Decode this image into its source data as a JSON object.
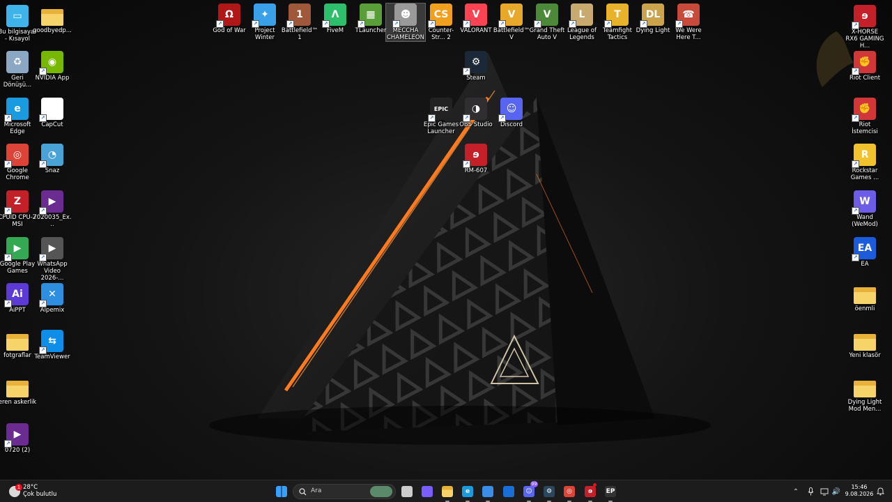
{
  "desktop": {
    "left_icons": [
      {
        "label": "Bu bilgisayar - Kısayol",
        "icon": "computer-icon",
        "color": "#3fb4ea"
      },
      {
        "label": "goodbyedp...",
        "icon": "folder-icon",
        "color": "#f3c74f"
      },
      {
        "label": "Geri Dönüşü...",
        "icon": "recycle-bin-icon",
        "color": "#8aa7c4"
      },
      {
        "label": "NVIDIA App",
        "icon": "nvidia-icon",
        "color": "#76b900"
      },
      {
        "label": "Microsoft Edge",
        "icon": "edge-icon",
        "color": "#1a9be0"
      },
      {
        "label": "CapCut",
        "icon": "capcut-icon",
        "color": "#ffffff"
      },
      {
        "label": "Google Chrome",
        "icon": "chrome-icon",
        "color": "#db4437"
      },
      {
        "label": "Snaz",
        "icon": "snaz-icon",
        "color": "#4aa3d6"
      },
      {
        "label": "CPUID CPU-Z MSI",
        "icon": "cpuz-icon",
        "color": "#c4202a"
      },
      {
        "label": "7020035_Ex...",
        "icon": "video-icon",
        "color": "#6a2c91"
      },
      {
        "label": "Google Play Games",
        "icon": "play-games-icon",
        "color": "#34a853"
      },
      {
        "label": "WhatsApp Video 2026-...",
        "icon": "video-file-icon",
        "color": "#555555"
      },
      {
        "label": "AiPPT",
        "icon": "aippt-icon",
        "color": "#5b3ad6"
      },
      {
        "label": "Alpemix",
        "icon": "alpemix-icon",
        "color": "#2e8fe0"
      },
      {
        "label": "fotgraflar",
        "icon": "folder-icon",
        "color": "#f3c74f"
      },
      {
        "label": "TeamViewer",
        "icon": "teamviewer-icon",
        "color": "#0e8ee9"
      },
      {
        "label": "eren askerlik",
        "icon": "folder-icon",
        "color": "#f3c74f"
      },
      {
        "label": "0720 (2)",
        "icon": "video-icon",
        "color": "#6a2c91"
      }
    ],
    "top_icons": [
      {
        "label": "God of War",
        "icon": "god-of-war-icon",
        "color": "#b01818"
      },
      {
        "label": "Project Winter",
        "icon": "project-winter-icon",
        "color": "#3aa0e8"
      },
      {
        "label": "Battlefield™ 1",
        "icon": "battlefield-1-icon",
        "color": "#a0583a"
      },
      {
        "label": "FiveM",
        "icon": "fivem-icon",
        "color": "#2dbf6b"
      },
      {
        "label": "TLauncher",
        "icon": "minecraft-icon",
        "color": "#5a9e3a"
      },
      {
        "label": "MECCHA CHAMELEON",
        "icon": "meccha-chameleon-icon",
        "color": "#9a9a9a"
      },
      {
        "label": "Counter-Str... 2",
        "icon": "cs2-icon",
        "color": "#f0a01e"
      },
      {
        "label": "VALORANT",
        "icon": "valorant-icon",
        "color": "#fa4454"
      },
      {
        "label": "Battlefield™ V",
        "icon": "battlefield-v-icon",
        "color": "#e8a82a"
      },
      {
        "label": "Grand Theft Auto V",
        "icon": "gta-v-icon",
        "color": "#4c8a3a"
      },
      {
        "label": "League of Legends",
        "icon": "league-icon",
        "color": "#c8aa6e"
      },
      {
        "label": "Teamfight Tactics",
        "icon": "tft-icon",
        "color": "#e8b32a"
      },
      {
        "label": "Dying Light",
        "icon": "dying-light-icon",
        "color": "#caa34a"
      },
      {
        "label": "We Were Here T...",
        "icon": "we-were-here-icon",
        "color": "#c84a3a"
      }
    ],
    "middle_icons": [
      {
        "label": "Steam",
        "icon": "steam-icon",
        "color": "#1b2838"
      },
      {
        "label": "Epic Games Launcher",
        "icon": "epic-games-icon",
        "color": "#222222"
      },
      {
        "label": "OBS Studio",
        "icon": "obs-icon",
        "color": "#302e31"
      },
      {
        "label": "Discord",
        "icon": "discord-icon",
        "color": "#5865f2"
      },
      {
        "label": "RM-607",
        "icon": "msi-dragon-icon",
        "color": "#c4202a"
      }
    ],
    "right_icons": [
      {
        "label": "X-HORSE RX6 GAMING H...",
        "icon": "msi-dragon-icon",
        "color": "#c4202a"
      },
      {
        "label": "Riot Client",
        "icon": "riot-icon",
        "color": "#d13639"
      },
      {
        "label": "Riot İstemcisi",
        "icon": "riot-icon",
        "color": "#d13639"
      },
      {
        "label": "Rockstar Games ...",
        "icon": "rockstar-icon",
        "color": "#f2c12e"
      },
      {
        "label": "Wand (WeMod)",
        "icon": "wand-icon",
        "color": "#6c5ce7"
      },
      {
        "label": "EA",
        "icon": "ea-icon",
        "color": "#1a5cdc"
      },
      {
        "label": "öenmli",
        "icon": "folder-icon",
        "color": "#f3c74f"
      },
      {
        "label": "Yeni klasör",
        "icon": "folder-icon",
        "color": "#f3c74f"
      },
      {
        "label": "Dying Light Mod Men...",
        "icon": "folder-icon",
        "color": "#f3c74f"
      }
    ]
  },
  "taskbar": {
    "weather_temp": "28°C",
    "weather_desc": "Çok bulutlu",
    "weather_badge": "1",
    "search_placeholder": "Ara",
    "pinned": [
      {
        "name": "start-button",
        "icon": "windows-icon",
        "color": "#3aa0ff"
      },
      {
        "name": "widgets-button",
        "icon": "widgets-icon",
        "color": "#3a9e4a"
      },
      {
        "name": "task-view-button",
        "icon": "task-view-icon",
        "color": "#cccccc"
      },
      {
        "name": "copilot-button",
        "icon": "copilot-icon",
        "color": "#7a5cff"
      },
      {
        "name": "file-explorer-button",
        "icon": "folder-icon",
        "color": "#f3c74f"
      },
      {
        "name": "edge-button",
        "icon": "edge-icon",
        "color": "#1a9be0"
      },
      {
        "name": "store-button",
        "icon": "store-icon",
        "color": "#3a8ee8"
      },
      {
        "name": "outlook-button",
        "icon": "outlook-icon",
        "color": "#1a6fd6"
      },
      {
        "name": "discord-button",
        "icon": "discord-icon",
        "color": "#5865f2"
      },
      {
        "name": "steam-button",
        "icon": "steam-icon",
        "color": "#2a475e"
      },
      {
        "name": "chrome-button",
        "icon": "chrome-icon",
        "color": "#db4437"
      },
      {
        "name": "msi-button",
        "icon": "msi-dragon-icon",
        "color": "#c4202a"
      },
      {
        "name": "epic-button",
        "icon": "epic-games-icon",
        "color": "#333333"
      }
    ],
    "discord_badge": "99",
    "clock_time": "15:46",
    "clock_date": "9.08.2026"
  }
}
